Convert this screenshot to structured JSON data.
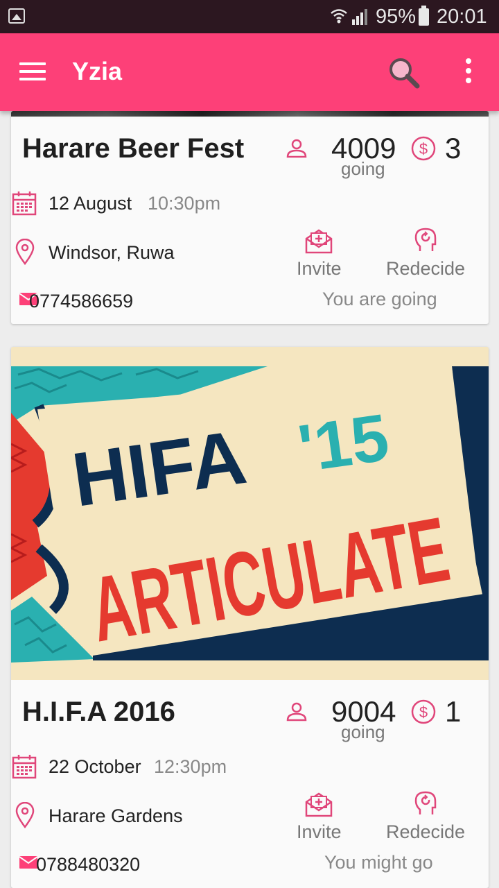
{
  "status_bar": {
    "battery": "95%",
    "time": "20:01",
    "icons": [
      "gallery-icon",
      "wifi-icon",
      "signal-icon",
      "battery-icon"
    ]
  },
  "app_bar": {
    "title": "Yzia",
    "icons": [
      "menu-icon",
      "search-icon",
      "more-vert-icon"
    ]
  },
  "colors": {
    "accent": "#fd4078",
    "status_bar": "#2c1720",
    "icon_pink": "#e0467a"
  },
  "events": [
    {
      "title": "Harare Beer Fest",
      "going_count": "4009",
      "going_label": "going",
      "price": "3",
      "date": "12 August",
      "time": "10:30pm",
      "venue": "Windsor, Ruwa",
      "phone": "0774586659",
      "invite_label": "Invite",
      "redecide_label": "Redecide",
      "status": "You are going"
    },
    {
      "title": "H.I.F.A 2016",
      "going_count": "9004",
      "going_label": "going",
      "price": "1",
      "date": "22 October",
      "time": "12:30pm",
      "venue": "Harare Gardens",
      "phone": "0788480320",
      "invite_label": "Invite",
      "redecide_label": "Redecide",
      "status": "You might go",
      "poster": {
        "line1": "HIFA",
        "line1_suffix": "'15",
        "line2": "ARTICULATE"
      }
    }
  ]
}
